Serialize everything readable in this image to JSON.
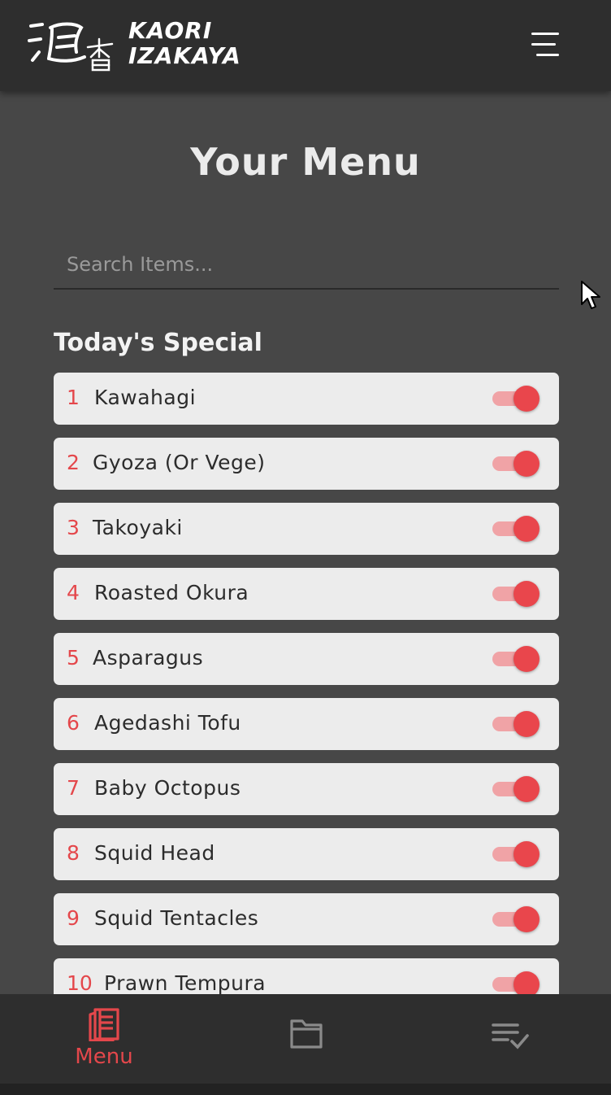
{
  "header": {
    "brand_line1": "KAORI",
    "brand_line2": "IZAKAYA",
    "logo_icon": "kaori-kanji-logo",
    "menu_icon": "hamburger-icon"
  },
  "main": {
    "title": "Your Menu",
    "search": {
      "placeholder": "Search Items...",
      "value": ""
    },
    "section_title": "Today's Special",
    "items": [
      {
        "number": "1",
        "name": "Kawahagi",
        "enabled": true
      },
      {
        "number": "2",
        "name": "Gyoza (Or Vege)",
        "enabled": true
      },
      {
        "number": "3",
        "name": "Takoyaki",
        "enabled": true
      },
      {
        "number": "4",
        "name": "Roasted Okura",
        "enabled": true
      },
      {
        "number": "5",
        "name": "Asparagus",
        "enabled": true
      },
      {
        "number": "6",
        "name": "Agedashi Tofu",
        "enabled": true
      },
      {
        "number": "7",
        "name": "Baby Octopus",
        "enabled": true
      },
      {
        "number": "8",
        "name": "Squid Head",
        "enabled": true
      },
      {
        "number": "9",
        "name": "Squid Tentacles",
        "enabled": true
      },
      {
        "number": "10",
        "name": "Prawn Tempura",
        "enabled": true
      }
    ]
  },
  "bottom_nav": {
    "menu_label": "Menu",
    "menu_icon": "menu-book-icon",
    "folder_icon": "folder-icon",
    "checklist_icon": "checklist-icon",
    "active_tab": "Menu"
  },
  "colors": {
    "accent": "#e4474b",
    "background": "#474747",
    "header": "#2e2e2e",
    "card": "#ececec",
    "toggle_track": "#f0a3a6",
    "toggle_knob": "#e9464c"
  }
}
